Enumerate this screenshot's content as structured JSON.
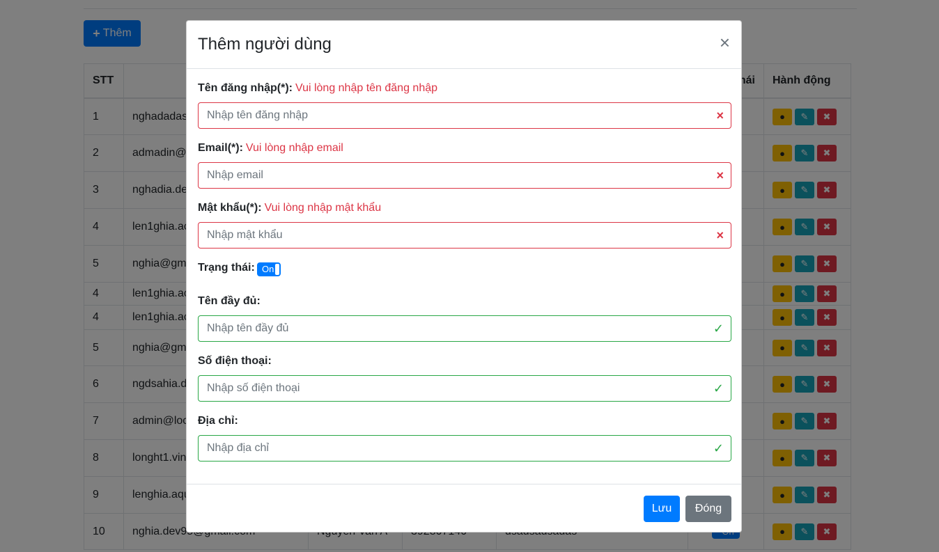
{
  "page": {
    "add_button_label": "Thêm",
    "table": {
      "headers": [
        "STT",
        "",
        "",
        "",
        "",
        "hái",
        "Hành động"
      ],
      "rows": [
        {
          "stt": "1",
          "user": "nghadadas",
          "name": "",
          "phone": "",
          "addr": "",
          "status": "on"
        },
        {
          "stt": "2",
          "user": "admadin@",
          "name": "",
          "phone": "",
          "addr": "",
          "status": "on"
        },
        {
          "stt": "3",
          "user": "nghadia.de",
          "name": "",
          "phone": "",
          "addr": "",
          "status": "on"
        },
        {
          "stt": "4",
          "user": "len1ghia.ac",
          "name": "",
          "phone": "",
          "addr": "",
          "status": "on"
        },
        {
          "stt": "5",
          "user": "nghia@gm",
          "name": "",
          "phone": "",
          "addr": "",
          "status": "off"
        },
        {
          "stt": "4",
          "user": "len1ghia.ac",
          "name": "",
          "phone": "",
          "addr": "",
          "status": "on"
        },
        {
          "stt": "4",
          "user": "len1ghia.ac",
          "name": "",
          "phone": "",
          "addr": "",
          "status": "on"
        },
        {
          "stt": "5",
          "user": "nghia@gm",
          "name": "",
          "phone": "",
          "addr": "",
          "status": "off"
        },
        {
          "stt": "6",
          "user": "ngdsahia.d",
          "name": "",
          "phone": "",
          "addr": "",
          "status": "on"
        },
        {
          "stt": "7",
          "user": "admin@loc",
          "name": "",
          "phone": "",
          "addr": "",
          "status": "off"
        },
        {
          "stt": "8",
          "user": "longht1.vin",
          "name": "",
          "phone": "",
          "addr": "",
          "status": "off"
        },
        {
          "stt": "9",
          "user": "lenghia.aqu",
          "name": "",
          "phone": "",
          "addr": "",
          "status": "off"
        },
        {
          "stt": "10",
          "user": "nghia.dev95@gmail.com",
          "name": "Nguyen Van A",
          "phone": "392807140",
          "addr": "dsadsadsadas",
          "status": "on"
        }
      ],
      "toggle_on_label": "On"
    }
  },
  "modal": {
    "title": "Thêm người dùng",
    "close_symbol": "×",
    "fields": {
      "username": {
        "label": "Tên đăng nhập(*):",
        "error": "Vui lòng nhập tên đăng nhập",
        "placeholder": "Nhập tên đăng nhập",
        "state_icon": "×"
      },
      "email": {
        "label": "Email(*):",
        "error": "Vui lòng nhập email",
        "placeholder": "Nhập email",
        "state_icon": "×"
      },
      "password": {
        "label": "Mật khẩu(*):",
        "error": "Vui lòng nhập mật khẩu",
        "placeholder": "Nhập mật khẩu",
        "state_icon": "×"
      },
      "status": {
        "label": "Trạng thái:",
        "toggle_label": "On"
      },
      "fullname": {
        "label": "Tên đầy đủ:",
        "placeholder": "Nhập tên đầy đủ",
        "state_icon": "✓"
      },
      "phone": {
        "label": "Số điện thoại:",
        "placeholder": "Nhập số điện thoại",
        "state_icon": "✓"
      },
      "address": {
        "label": "Địa chỉ:",
        "placeholder": "Nhập địa chỉ",
        "state_icon": "✓"
      }
    },
    "buttons": {
      "save": "Lưu",
      "close": "Đóng"
    }
  },
  "colors": {
    "primary": "#007bff",
    "danger": "#dc3545",
    "success": "#28a745",
    "secondary": "#6c757d",
    "warning": "#ffc107",
    "info": "#17a2b8"
  }
}
